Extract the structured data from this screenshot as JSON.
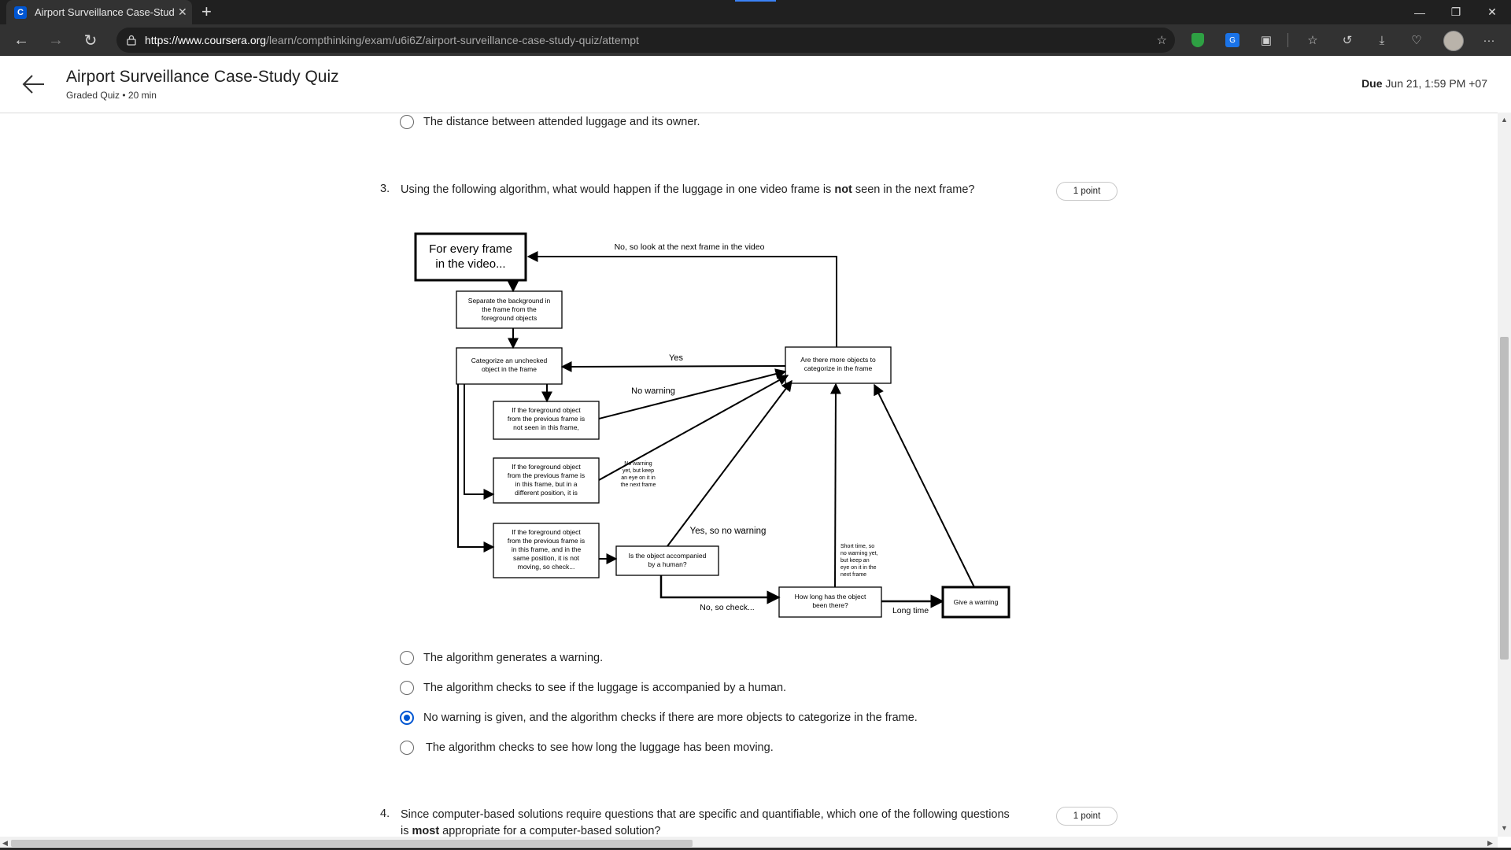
{
  "browser": {
    "tab_title": "Airport Surveillance Case-Study Q",
    "favicon_letter": "C",
    "url_host": "https://www.coursera.org",
    "url_path": "/learn/compthinking/exam/u6i6Z/airport-surveillance-case-study-quiz/attempt",
    "icons": [
      "back-icon",
      "forward-icon",
      "reload-icon",
      "lock-icon",
      "add-favorite-icon",
      "shield-extension-icon",
      "translate-extension-icon",
      "collections-icon",
      "favorites-icon",
      "history-icon",
      "download-icon",
      "browser-essentials-icon",
      "profile-icon",
      "more-icon",
      "minimize-icon",
      "restore-icon",
      "close-icon"
    ],
    "translate_glyph": "G"
  },
  "header": {
    "title": "Airport Surveillance Case-Study Quiz",
    "subtitle": "Graded Quiz • 20 min",
    "due_label": "Due",
    "due_date": "Jun 21, 1:59 PM +07"
  },
  "prev_option": {
    "text": "The distance between attended luggage and its owner.",
    "selected": false
  },
  "question3": {
    "number": "3.",
    "text_before": "Using the following algorithm, what would happen if the luggage in one video frame is ",
    "text_bold": "not",
    "text_after": " seen in the next frame?",
    "points": "1 point",
    "options": [
      {
        "text": "The algorithm generates a warning.",
        "selected": false
      },
      {
        "text": "The algorithm checks to see if the luggage is accompanied by a human.",
        "selected": false
      },
      {
        "text": "No warning is given, and the algorithm checks if there are more objects to categorize in the frame.",
        "selected": true
      },
      {
        "text": "The algorithm checks to see how long the luggage has been moving.",
        "selected": false
      }
    ]
  },
  "question4": {
    "number": "4.",
    "line1": "Since computer-based solutions require questions that are specific and quantifiable, which one of the following questions",
    "line2_before": "is ",
    "line2_bold": "most",
    "line2_after": " appropriate for a computer-based solution?",
    "points": "1 point"
  },
  "flowchart": {
    "start": [
      "For every frame",
      "in the video..."
    ],
    "separate": [
      "Separate the background in",
      "the frame from the",
      "foreground objects"
    ],
    "categorize": [
      "Categorize an unchecked",
      "object in the frame"
    ],
    "more_objects": [
      "Are there more objects to",
      "categorize in the frame"
    ],
    "not_seen": [
      "If the foreground object",
      "from the previous frame is",
      "not seen in this frame,"
    ],
    "diff_pos": [
      "If the foreground object",
      "from the previous frame is",
      "in this frame, but in a",
      "different position, it is"
    ],
    "same_pos": [
      "If the foreground object",
      "from the previous frame is",
      "in this frame, and in the",
      "same position, it is not",
      "moving, so check..."
    ],
    "accompanied": [
      "Is the object accompanied",
      "by a human?"
    ],
    "how_long": [
      "How long has the object",
      "been there?"
    ],
    "give_warning": "Give a warning",
    "label_next_frame": "No, so look at the next frame in the video",
    "label_yes": "Yes",
    "label_no_warning": "No warning",
    "label_no_warning_eye": [
      "No warning",
      "yet, but keep",
      "an eye on it in",
      "the next frame"
    ],
    "label_yes_no_warning": "Yes, so no warning",
    "label_no_check": "No, so check...",
    "label_short_time": [
      "Short time, so",
      "no warning yet,",
      "but keep an",
      "eye on it in the",
      "next frame"
    ],
    "label_long_time": "Long time"
  }
}
